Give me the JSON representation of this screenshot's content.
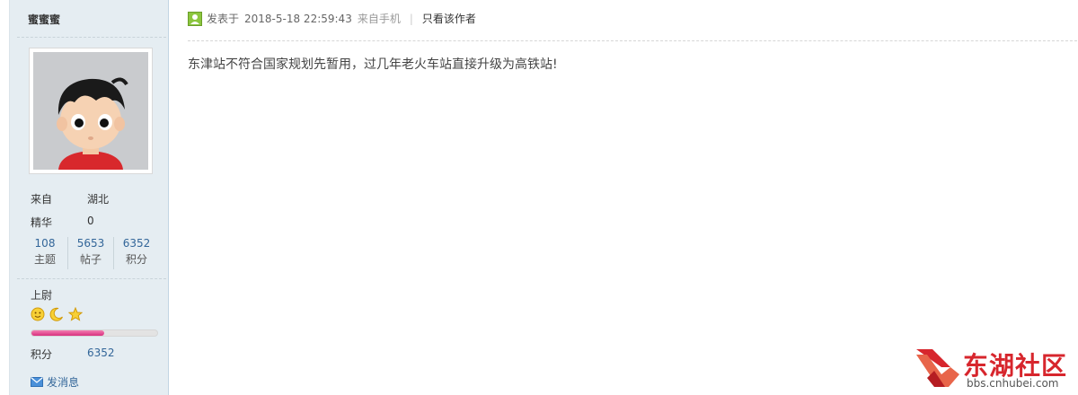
{
  "author": {
    "username": "蜜蜜蜜",
    "from_label": "来自",
    "from_value": "湖北",
    "essence_label": "精华",
    "essence_value": "0",
    "stats": [
      {
        "num": "108",
        "label": "主题"
      },
      {
        "num": "5653",
        "label": "帖子"
      },
      {
        "num": "6352",
        "label": "积分"
      }
    ],
    "rank": "上尉",
    "medal_icons": [
      "sun-icon",
      "moon-icon",
      "star-icon"
    ],
    "progress_fraction": 0.58,
    "points_label": "积分",
    "points_value": "6352",
    "send_message": "发消息"
  },
  "post": {
    "published_prefix": "发表于",
    "datetime": "2018-5-18 22:59:43",
    "source": "来自手机",
    "separator": "|",
    "only_author": "只看该作者",
    "content": "东津站不符合国家规划先暂用，过几年老火车站直接升级为高铁站!"
  },
  "watermark": {
    "brand": "东湖社区",
    "url": "bbs.cnhubei.com"
  },
  "colors": {
    "sidebar_bg": "#e5edf2",
    "link_blue": "#336699",
    "progress_pink": "#e2468f",
    "brand_red": "#d7262d"
  }
}
